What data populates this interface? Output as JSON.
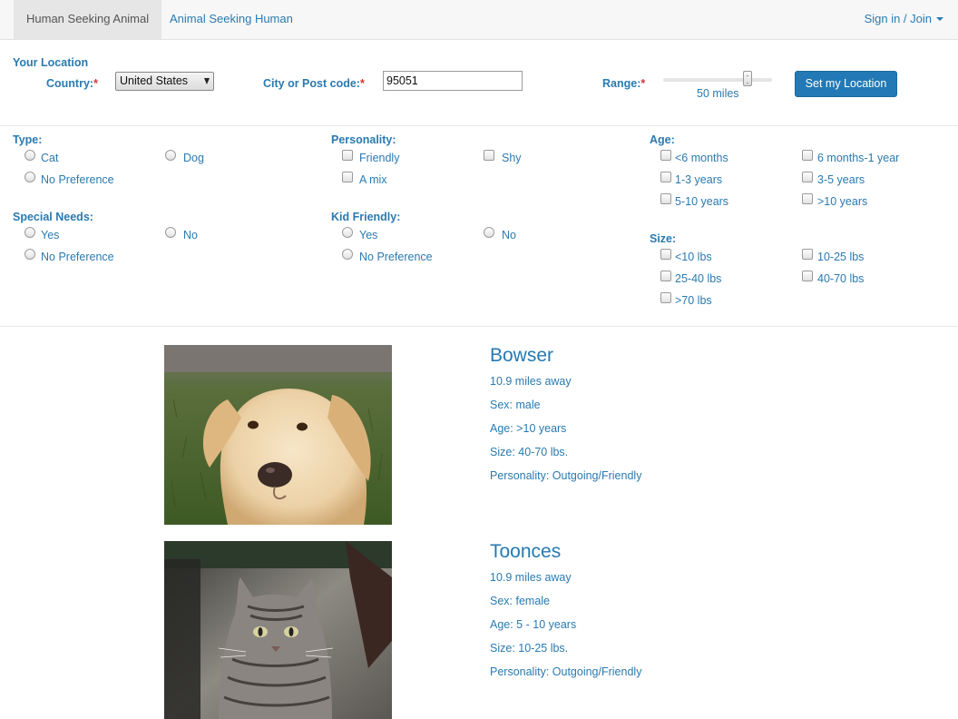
{
  "nav": {
    "tabs": [
      {
        "label": "Human Seeking Animal",
        "active": true
      },
      {
        "label": "Animal Seeking Human",
        "active": false
      }
    ],
    "signin_label": "Sign in / Join"
  },
  "location": {
    "heading": "Your Location",
    "country_label": "Country:",
    "country_value": "United States",
    "city_label": "City or Post code:",
    "city_value": "95051",
    "range_label": "Range:",
    "range_value_label": "50 miles",
    "range_fraction": 0.75,
    "required_mark": "*",
    "set_location_label": "Set my Location"
  },
  "filters": {
    "type": {
      "heading": "Type:",
      "options": [
        "Cat",
        "Dog",
        "No Preference"
      ]
    },
    "special_needs": {
      "heading": "Special Needs:",
      "options": [
        "Yes",
        "No",
        "No Preference"
      ]
    },
    "personality": {
      "heading": "Personality:",
      "options": [
        "Friendly",
        "Shy",
        "A mix"
      ]
    },
    "kid_friendly": {
      "heading": "Kid Friendly:",
      "options": [
        "Yes",
        "No",
        "No Preference"
      ]
    },
    "age": {
      "heading": "Age:",
      "options": [
        "<6 months",
        "6 months-1 year",
        "1-3 years",
        "3-5 years",
        "5-10 years",
        ">10 years"
      ]
    },
    "size": {
      "heading": "Size:",
      "options": [
        "<10 lbs",
        "10-25 lbs",
        "25-40 lbs",
        "40-70 lbs",
        ">70 lbs"
      ]
    }
  },
  "results": [
    {
      "name": "Bowser",
      "distance": "10.9 miles away",
      "sex": "Sex: male",
      "age": "Age: >10 years",
      "size": "Size: 40-70 lbs.",
      "personality": "Personality: Outgoing/Friendly"
    },
    {
      "name": "Toonces",
      "distance": "10.9 miles away",
      "sex": "Sex: female",
      "age": "Age: 5 - 10 years",
      "size": "Size: 10-25 lbs.",
      "personality": "Personality: Outgoing/Friendly"
    }
  ]
}
